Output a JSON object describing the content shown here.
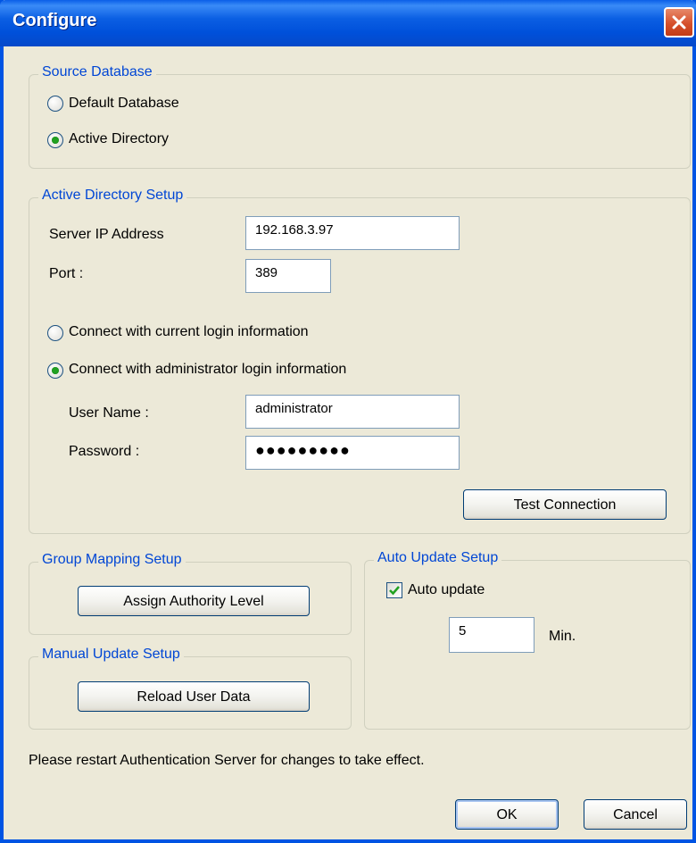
{
  "window": {
    "title": "Configure"
  },
  "source_database": {
    "legend": "Source Database",
    "options": [
      {
        "label": "Default Database",
        "selected": false
      },
      {
        "label": "Active Directory",
        "selected": true
      }
    ]
  },
  "ad_setup": {
    "legend": "Active Directory Setup",
    "server_ip_label": "Server IP Address",
    "server_ip_value": "192.168.3.97",
    "port_label": "Port :",
    "port_value": "389",
    "connect_options": [
      {
        "label": "Connect with current login information",
        "selected": false
      },
      {
        "label": "Connect with administrator login information",
        "selected": true
      }
    ],
    "username_label": "User Name :",
    "username_value": "administrator",
    "password_label": "Password :",
    "password_value": "●●●●●●●●●",
    "test_button": "Test Connection"
  },
  "group_mapping": {
    "legend": "Group Mapping Setup",
    "button": "Assign Authority Level"
  },
  "manual_update": {
    "legend": "Manual Update Setup",
    "button": "Reload User Data"
  },
  "auto_update": {
    "legend": "Auto Update Setup",
    "checkbox_label": "Auto update",
    "checked": true,
    "interval_value": "5",
    "interval_unit": "Min."
  },
  "footer": {
    "notice": "Please restart Authentication Server for changes to take effect.",
    "ok": "OK",
    "cancel": "Cancel"
  },
  "colors": {
    "title_bar": "#0054e3",
    "legend_text": "#0046d5",
    "dialog_bg": "#ece9d8",
    "radio_dot": "#21a121"
  }
}
